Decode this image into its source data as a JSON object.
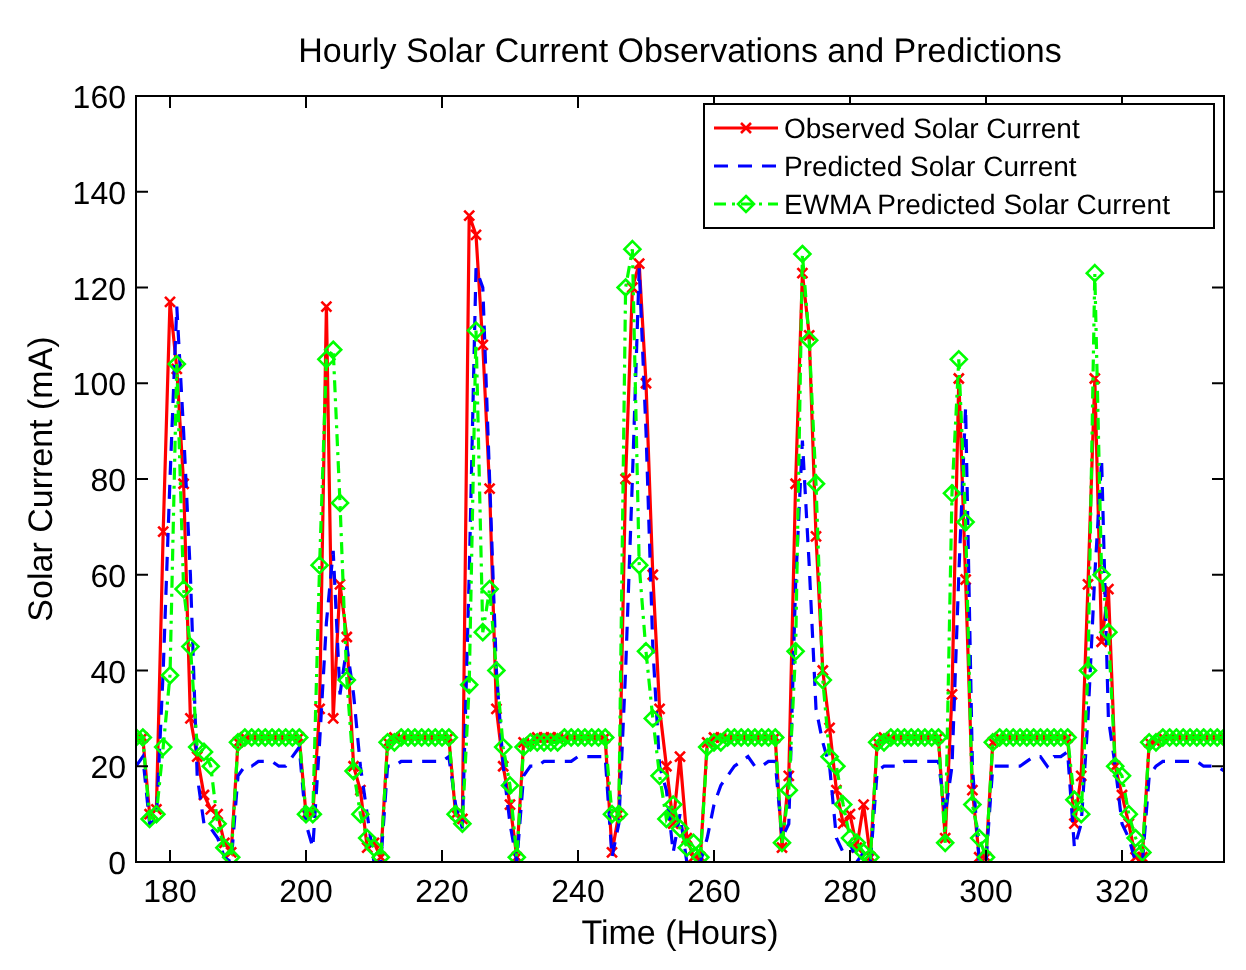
{
  "figure": {
    "chart_data": {
      "type": "line",
      "title": "Hourly Solar Current Observations and Predictions",
      "xlabel": "Time (Hours)",
      "ylabel": "Solar Current (mA)",
      "xlim": [
        175,
        335
      ],
      "ylim": [
        0,
        160
      ],
      "xticks": [
        180,
        200,
        220,
        240,
        260,
        280,
        300,
        320
      ],
      "yticks": [
        0,
        20,
        40,
        60,
        80,
        100,
        120,
        140,
        160
      ],
      "legend": true,
      "x": [
        175,
        176,
        177,
        178,
        179,
        180,
        181,
        182,
        183,
        184,
        185,
        186,
        187,
        188,
        189,
        190,
        191,
        192,
        193,
        194,
        195,
        196,
        197,
        198,
        199,
        200,
        201,
        202,
        203,
        204,
        205,
        206,
        207,
        208,
        209,
        210,
        211,
        212,
        213,
        214,
        215,
        216,
        217,
        218,
        219,
        220,
        221,
        222,
        223,
        224,
        225,
        226,
        227,
        228,
        229,
        230,
        231,
        232,
        233,
        234,
        235,
        236,
        237,
        238,
        239,
        240,
        241,
        242,
        243,
        244,
        245,
        246,
        247,
        248,
        249,
        250,
        251,
        252,
        253,
        254,
        255,
        256,
        257,
        258,
        259,
        260,
        261,
        262,
        263,
        264,
        265,
        266,
        267,
        268,
        269,
        270,
        271,
        272,
        273,
        274,
        275,
        276,
        277,
        278,
        279,
        280,
        281,
        282,
        283,
        284,
        285,
        286,
        287,
        288,
        289,
        290,
        291,
        292,
        293,
        294,
        295,
        296,
        297,
        298,
        299,
        300,
        301,
        302,
        303,
        304,
        305,
        306,
        307,
        308,
        309,
        310,
        311,
        312,
        313,
        314,
        315,
        316,
        317,
        318,
        319,
        320,
        321,
        322,
        323,
        324,
        325,
        326,
        327,
        328,
        329,
        330,
        331,
        332,
        333,
        334,
        335
      ],
      "series": [
        {
          "name": "Observed Solar Current",
          "color": "#ff0000",
          "line_style": "solid",
          "marker": "x",
          "values": [
            26,
            26,
            10,
            11,
            69,
            117,
            103,
            79,
            30,
            22,
            14,
            11,
            10,
            4,
            2,
            25,
            26,
            26,
            26,
            26,
            26,
            26,
            26,
            26,
            26,
            10,
            10,
            32,
            116,
            30,
            58,
            47,
            20,
            15,
            3,
            4,
            1,
            25,
            26,
            26,
            26,
            26,
            26,
            26,
            26,
            26,
            26,
            10,
            9,
            135,
            131,
            108,
            78,
            32,
            20,
            12,
            1,
            25,
            25,
            26,
            26,
            26,
            26,
            26,
            26,
            26,
            26,
            26,
            26,
            26,
            2,
            10,
            80,
            120,
            125,
            100,
            60,
            32,
            20,
            8,
            22,
            5,
            1,
            1,
            25,
            26,
            26,
            26,
            26,
            26,
            26,
            26,
            26,
            26,
            26,
            3,
            18,
            79,
            123,
            110,
            68,
            40,
            28,
            15,
            8,
            10,
            3,
            12,
            1,
            25,
            26,
            26,
            26,
            26,
            26,
            26,
            26,
            26,
            26,
            5,
            35,
            101,
            59,
            15,
            1,
            1,
            25,
            26,
            26,
            26,
            26,
            26,
            26,
            26,
            26,
            26,
            26,
            26,
            8,
            18,
            58,
            101,
            46,
            57,
            20,
            14,
            8,
            1,
            1,
            25,
            25,
            26,
            26,
            26,
            26,
            26,
            26,
            26,
            26,
            26,
            26
          ]
        },
        {
          "name": "Predicted Solar Current",
          "color": "#0000ff",
          "line_style": "dashed",
          "values": [
            20,
            22,
            8,
            9,
            40,
            80,
            116,
            90,
            60,
            18,
            8,
            7,
            5,
            1,
            0,
            18,
            20,
            20,
            21,
            21,
            21,
            20,
            20,
            22,
            24,
            8,
            3,
            25,
            50,
            65,
            35,
            45,
            35,
            20,
            10,
            0,
            0,
            20,
            20,
            21,
            21,
            21,
            21,
            21,
            21,
            21,
            22,
            12,
            7,
            60,
            124,
            120,
            80,
            40,
            20,
            8,
            0,
            18,
            20,
            20,
            21,
            21,
            21,
            21,
            21,
            22,
            22,
            22,
            22,
            22,
            1,
            8,
            40,
            80,
            124,
            90,
            45,
            20,
            15,
            2,
            10,
            0,
            0,
            0,
            5,
            12,
            16,
            18,
            20,
            21,
            22,
            20,
            20,
            21,
            21,
            5,
            8,
            58,
            88,
            62,
            32,
            25,
            20,
            5,
            2,
            4,
            0,
            2,
            0,
            19,
            20,
            20,
            20,
            21,
            21,
            21,
            21,
            21,
            21,
            10,
            20,
            60,
            95,
            20,
            0,
            0,
            20,
            20,
            20,
            20,
            20,
            21,
            22,
            22,
            20,
            22,
            22,
            23,
            3,
            8,
            30,
            60,
            84,
            30,
            20,
            8,
            5,
            0,
            0,
            18,
            20,
            21,
            21,
            21,
            21,
            21,
            21,
            20,
            20,
            20,
            19
          ]
        },
        {
          "name": "EWMA Predicted Solar Current",
          "color": "#00ff00",
          "line_style": "dashdot",
          "marker": "diamond",
          "values": [
            26,
            26,
            9,
            10,
            24,
            39,
            104,
            57,
            45,
            24,
            23,
            20,
            8,
            3,
            1,
            25,
            26,
            26,
            26,
            26,
            26,
            26,
            26,
            26,
            26,
            10,
            10,
            62,
            105,
            107,
            75,
            38,
            19,
            10,
            5,
            3,
            1,
            25,
            25,
            26,
            26,
            26,
            26,
            26,
            26,
            26,
            26,
            10,
            8,
            37,
            111,
            48,
            57,
            40,
            24,
            16,
            1,
            24,
            25,
            25,
            25,
            25,
            25,
            26,
            26,
            26,
            26,
            26,
            26,
            26,
            10,
            10,
            120,
            128,
            62,
            44,
            30,
            18,
            9,
            12,
            7,
            3,
            4,
            1,
            24,
            25,
            25,
            26,
            26,
            26,
            26,
            26,
            26,
            26,
            26,
            4,
            15,
            44,
            127,
            109,
            79,
            38,
            22,
            20,
            12,
            5,
            4,
            2,
            1,
            25,
            25,
            26,
            26,
            26,
            26,
            26,
            26,
            26,
            26,
            4,
            77,
            105,
            71,
            12,
            5,
            1,
            25,
            26,
            26,
            26,
            26,
            26,
            26,
            26,
            26,
            26,
            26,
            26,
            13,
            10,
            40,
            123,
            60,
            48,
            20,
            18,
            10,
            5,
            2,
            25,
            25,
            26,
            26,
            26,
            26,
            26,
            26,
            26,
            26,
            26,
            26
          ]
        }
      ]
    }
  }
}
